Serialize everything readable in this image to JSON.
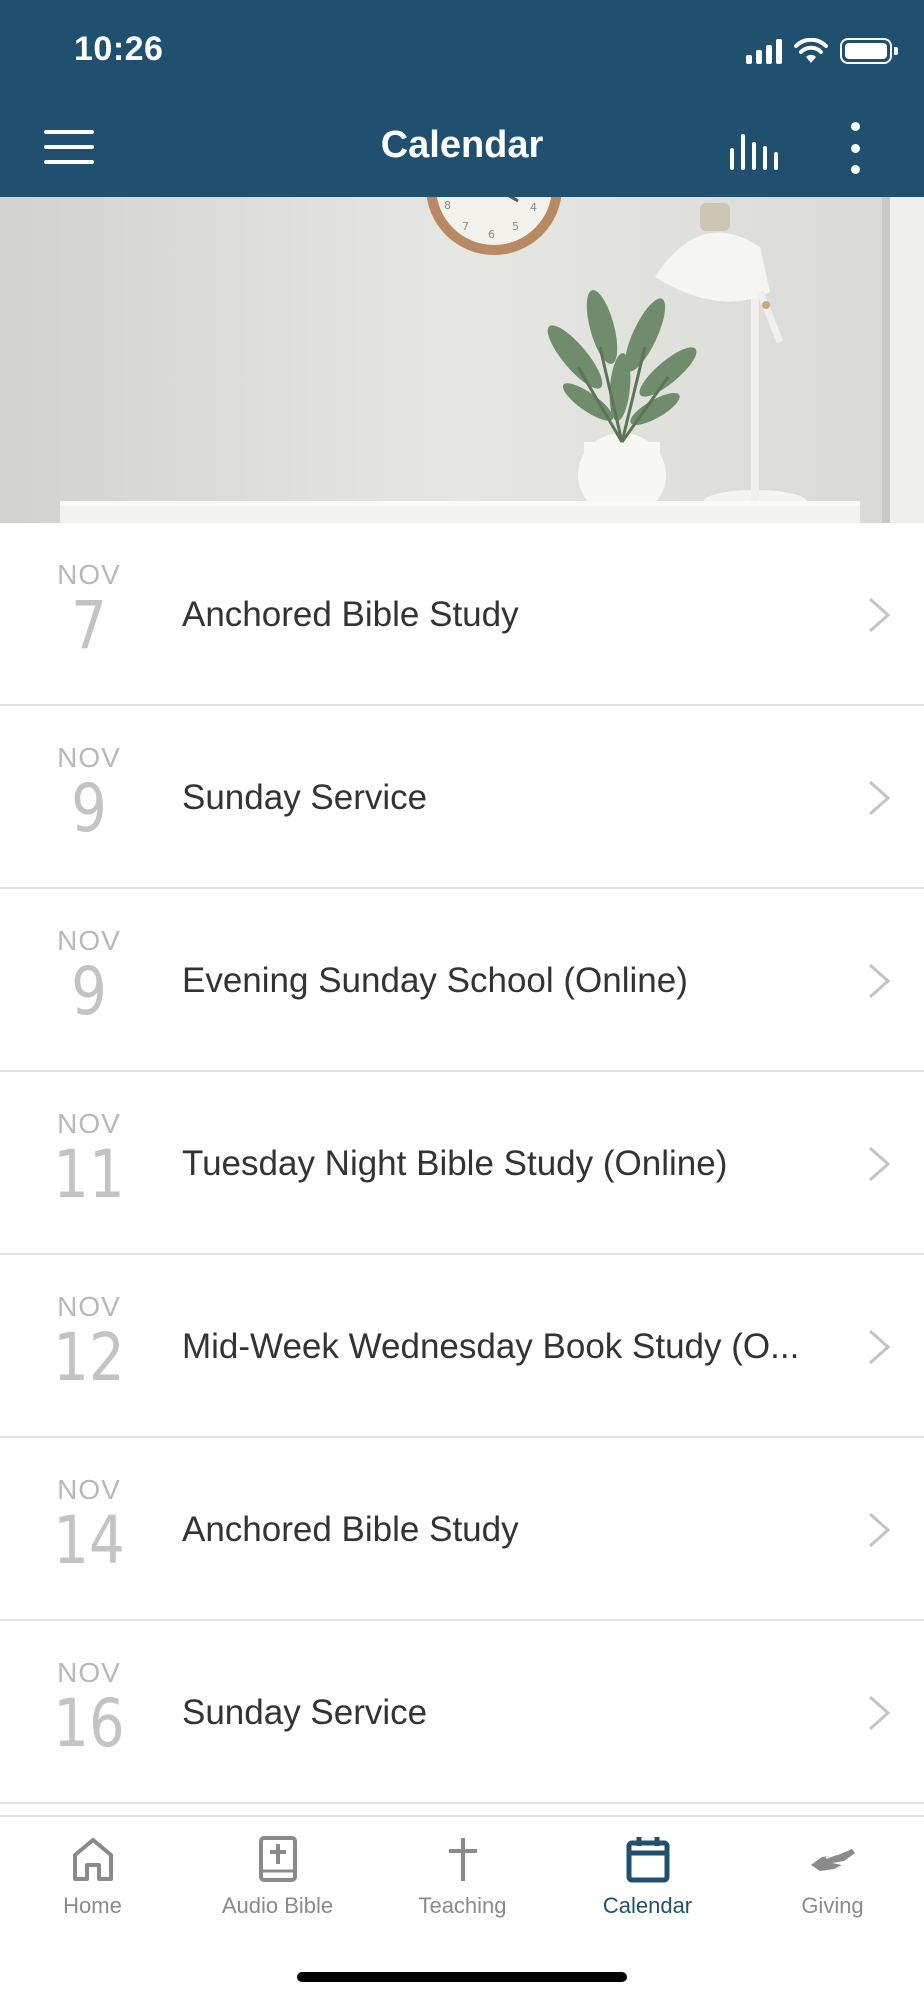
{
  "status_bar": {
    "time": "10:26"
  },
  "header": {
    "title": "Calendar",
    "menu_icon": "hamburger-menu-icon",
    "stats_icon": "bar-chart-icon",
    "more_icon": "vertical-ellipsis-icon",
    "background": "#1f5070"
  },
  "events": [
    {
      "month": "NOV",
      "day": "7",
      "title": "Anchored Bible Study"
    },
    {
      "month": "NOV",
      "day": "9",
      "title": "Sunday Service"
    },
    {
      "month": "NOV",
      "day": "9",
      "title": "Evening Sunday School (Online)"
    },
    {
      "month": "NOV",
      "day": "11",
      "title": "Tuesday Night Bible Study (Online)"
    },
    {
      "month": "NOV",
      "day": "12",
      "title": "Mid-Week Wednesday Book Study (O..."
    },
    {
      "month": "NOV",
      "day": "14",
      "title": "Anchored Bible Study"
    },
    {
      "month": "NOV",
      "day": "16",
      "title": "Sunday Service"
    }
  ],
  "tabs": [
    {
      "label": "Home",
      "icon": "home-icon",
      "active": false
    },
    {
      "label": "Audio Bible",
      "icon": "bible-book-icon",
      "active": false
    },
    {
      "label": "Teaching",
      "icon": "cross-icon",
      "active": false
    },
    {
      "label": "Calendar",
      "icon": "calendar-icon",
      "active": true
    },
    {
      "label": "Giving",
      "icon": "giving-hand-icon",
      "active": false
    }
  ],
  "colors": {
    "accent": "#1f5070",
    "inactive_tab": "#8a8a8a",
    "date_text": "#c3c3c3"
  }
}
